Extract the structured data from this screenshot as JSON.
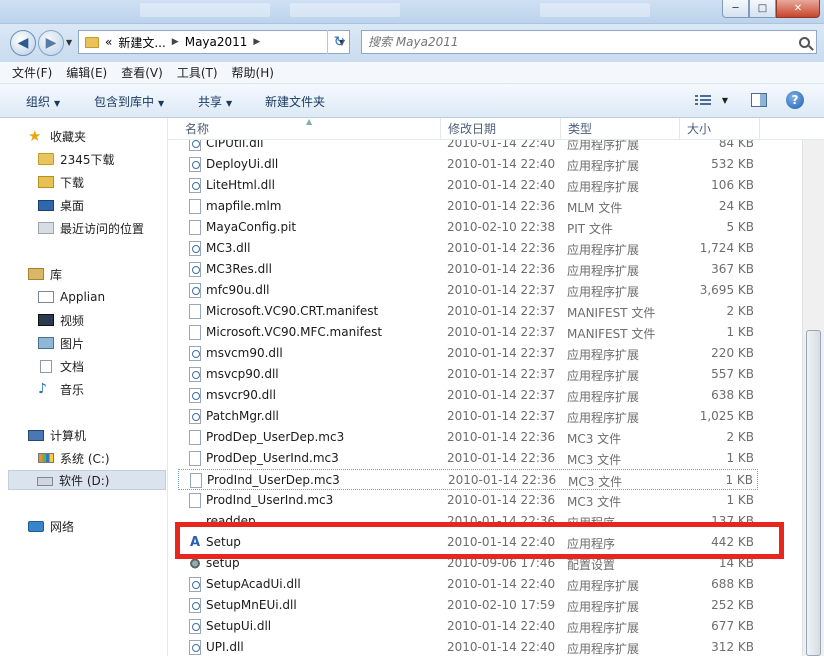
{
  "window": {
    "close_label": "✕",
    "minimize_label": "─",
    "maximize_label": "□"
  },
  "address": {
    "overflow": "«",
    "crumbs": [
      "新建文...",
      "Maya2011"
    ],
    "search_placeholder": "搜索 Maya2011"
  },
  "menu": [
    "文件(F)",
    "编辑(E)",
    "查看(V)",
    "工具(T)",
    "帮助(H)"
  ],
  "toolbar": {
    "organize": "组织",
    "include_library": "包含到库中",
    "share": "共享",
    "new_folder": "新建文件夹"
  },
  "sidebar": {
    "favorites": "收藏夹",
    "fav_items": [
      "2345下载",
      "下载",
      "桌面",
      "最近访问的位置"
    ],
    "libraries": "库",
    "lib_items": [
      "Applian",
      "视频",
      "图片",
      "文档",
      "音乐"
    ],
    "computer": "计算机",
    "computer_items": [
      "系统 (C:)",
      "软件 (D:)"
    ],
    "network": "网络"
  },
  "columns": {
    "name": "名称",
    "date": "修改日期",
    "type": "类型",
    "size": "大小"
  },
  "files": [
    {
      "name": "CIPUtil.dll",
      "date": "2010-01-14 22:40",
      "type": "应用程序扩展",
      "size": "84 KB",
      "icon": "dll"
    },
    {
      "name": "DeployUi.dll",
      "date": "2010-01-14 22:40",
      "type": "应用程序扩展",
      "size": "532 KB",
      "icon": "dll"
    },
    {
      "name": "LiteHtml.dll",
      "date": "2010-01-14 22:40",
      "type": "应用程序扩展",
      "size": "106 KB",
      "icon": "dll"
    },
    {
      "name": "mapfile.mlm",
      "date": "2010-01-14 22:36",
      "type": "MLM 文件",
      "size": "24 KB",
      "icon": "doc"
    },
    {
      "name": "MayaConfig.pit",
      "date": "2010-02-10 22:38",
      "type": "PIT 文件",
      "size": "5 KB",
      "icon": "doc"
    },
    {
      "name": "MC3.dll",
      "date": "2010-01-14 22:36",
      "type": "应用程序扩展",
      "size": "1,724 KB",
      "icon": "dll"
    },
    {
      "name": "MC3Res.dll",
      "date": "2010-01-14 22:36",
      "type": "应用程序扩展",
      "size": "367 KB",
      "icon": "dll"
    },
    {
      "name": "mfc90u.dll",
      "date": "2010-01-14 22:37",
      "type": "应用程序扩展",
      "size": "3,695 KB",
      "icon": "dll"
    },
    {
      "name": "Microsoft.VC90.CRT.manifest",
      "date": "2010-01-14 22:37",
      "type": "MANIFEST 文件",
      "size": "2 KB",
      "icon": "doc"
    },
    {
      "name": "Microsoft.VC90.MFC.manifest",
      "date": "2010-01-14 22:37",
      "type": "MANIFEST 文件",
      "size": "1 KB",
      "icon": "doc"
    },
    {
      "name": "msvcm90.dll",
      "date": "2010-01-14 22:37",
      "type": "应用程序扩展",
      "size": "220 KB",
      "icon": "dll"
    },
    {
      "name": "msvcp90.dll",
      "date": "2010-01-14 22:37",
      "type": "应用程序扩展",
      "size": "557 KB",
      "icon": "dll"
    },
    {
      "name": "msvcr90.dll",
      "date": "2010-01-14 22:37",
      "type": "应用程序扩展",
      "size": "638 KB",
      "icon": "dll"
    },
    {
      "name": "PatchMgr.dll",
      "date": "2010-01-14 22:37",
      "type": "应用程序扩展",
      "size": "1,025 KB",
      "icon": "dll"
    },
    {
      "name": "ProdDep_UserDep.mc3",
      "date": "2010-01-14 22:36",
      "type": "MC3 文件",
      "size": "2 KB",
      "icon": "doc"
    },
    {
      "name": "ProdDep_UserInd.mc3",
      "date": "2010-01-14 22:36",
      "type": "MC3 文件",
      "size": "1 KB",
      "icon": "doc"
    },
    {
      "name": "ProdInd_UserDep.mc3",
      "date": "2010-01-14 22:36",
      "type": "MC3 文件",
      "size": "1 KB",
      "icon": "doc"
    },
    {
      "name": "ProdInd_UserInd.mc3",
      "date": "2010-01-14 22:36",
      "type": "MC3 文件",
      "size": "1 KB",
      "icon": "doc"
    },
    {
      "name": "readdep",
      "date": "2010-01-14 22:36",
      "type": "应用程序",
      "size": "137 KB",
      "icon": "exe"
    },
    {
      "name": "Setup",
      "date": "2010-01-14 22:40",
      "type": "应用程序",
      "size": "442 KB",
      "icon": "exe"
    },
    {
      "name": "setup",
      "date": "2010-09-06 17:46",
      "type": "配置设置",
      "size": "14 KB",
      "icon": "cfg"
    },
    {
      "name": "SetupAcadUi.dll",
      "date": "2010-01-14 22:40",
      "type": "应用程序扩展",
      "size": "688 KB",
      "icon": "dll"
    },
    {
      "name": "SetupMnEUi.dll",
      "date": "2010-02-10 17:59",
      "type": "应用程序扩展",
      "size": "252 KB",
      "icon": "dll"
    },
    {
      "name": "SetupUi.dll",
      "date": "2010-01-14 22:40",
      "type": "应用程序扩展",
      "size": "677 KB",
      "icon": "dll"
    },
    {
      "name": "UPI.dll",
      "date": "2010-01-14 22:40",
      "type": "应用程序扩展",
      "size": "312 KB",
      "icon": "dll"
    }
  ],
  "colors": {
    "highlight_box": "#e8261e"
  }
}
